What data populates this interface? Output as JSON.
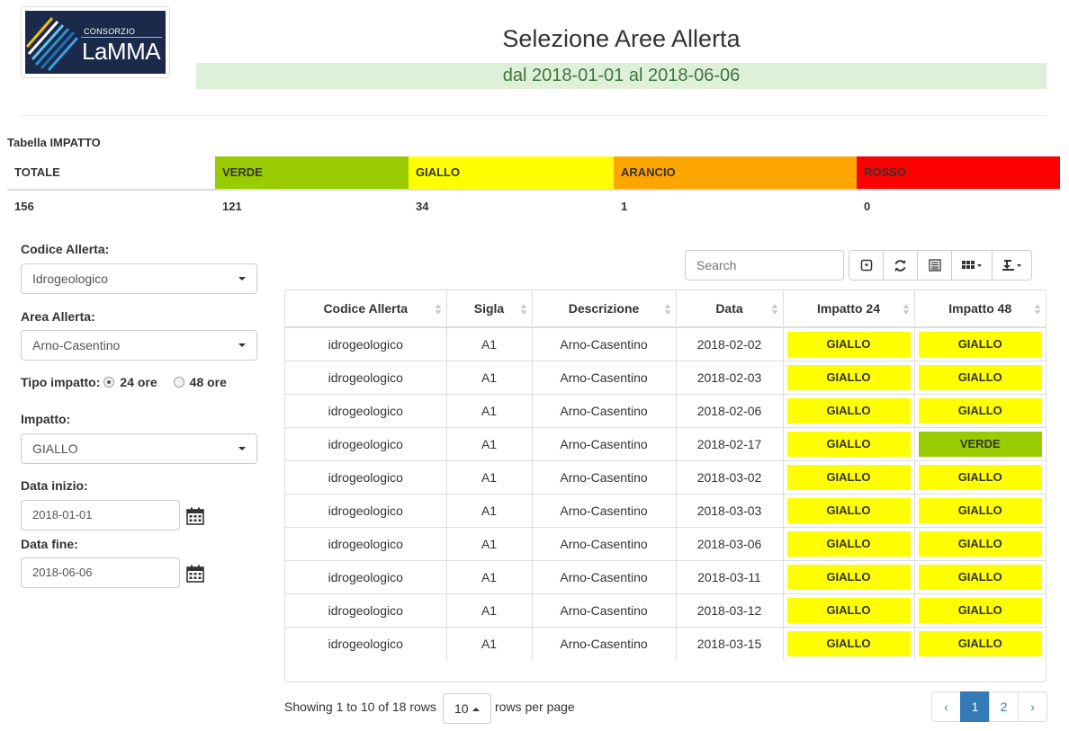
{
  "header": {
    "logo_small": "CONSORZIO",
    "logo_big": "LaMMA",
    "title": "Selezione Aree Allerta",
    "date_range": "dal 2018-01-01 al 2018-06-06"
  },
  "impact": {
    "caption": "Tabella IMPATTO",
    "headers": [
      "TOTALE",
      "VERDE",
      "GIALLO",
      "ARANCIO",
      "ROSSO"
    ],
    "values": [
      "156",
      "121",
      "34",
      "1",
      "0"
    ],
    "colors": {
      "verde": "#99cc00",
      "giallo": "#ffff00",
      "arancio": "#ffa500",
      "rosso": "#ff0000"
    }
  },
  "filters": {
    "codice_label": "Codice Allerta:",
    "codice_value": "Idrogeologico",
    "area_label": "Area Allerta:",
    "area_value": "Arno-Casentino",
    "tipo_label": "Tipo impatto:",
    "tipo_opt1": "24 ore",
    "tipo_opt2": "48 ore",
    "tipo_selected": "24 ore",
    "impatto_label": "Impatto:",
    "impatto_value": "GIALLO",
    "data_inizio_label": "Data inizio:",
    "data_inizio_value": "2018-01-01",
    "data_fine_label": "Data fine:",
    "data_fine_value": "2018-06-06"
  },
  "toolbar": {
    "search_placeholder": "Search",
    "icons": [
      "toggle-icon",
      "refresh-icon",
      "list-icon",
      "columns-icon",
      "export-icon"
    ]
  },
  "table": {
    "columns": [
      "Codice Allerta",
      "Sigla",
      "Descrizione",
      "Data",
      "Impatto 24",
      "Impatto 48"
    ],
    "rows": [
      [
        "idrogeologico",
        "A1",
        "Arno-Casentino",
        "2018-02-02",
        "GIALLO",
        "GIALLO"
      ],
      [
        "idrogeologico",
        "A1",
        "Arno-Casentino",
        "2018-02-03",
        "GIALLO",
        "GIALLO"
      ],
      [
        "idrogeologico",
        "A1",
        "Arno-Casentino",
        "2018-02-06",
        "GIALLO",
        "GIALLO"
      ],
      [
        "idrogeologico",
        "A1",
        "Arno-Casentino",
        "2018-02-17",
        "GIALLO",
        "VERDE"
      ],
      [
        "idrogeologico",
        "A1",
        "Arno-Casentino",
        "2018-03-02",
        "GIALLO",
        "GIALLO"
      ],
      [
        "idrogeologico",
        "A1",
        "Arno-Casentino",
        "2018-03-03",
        "GIALLO",
        "GIALLO"
      ],
      [
        "idrogeologico",
        "A1",
        "Arno-Casentino",
        "2018-03-06",
        "GIALLO",
        "GIALLO"
      ],
      [
        "idrogeologico",
        "A1",
        "Arno-Casentino",
        "2018-03-11",
        "GIALLO",
        "GIALLO"
      ],
      [
        "idrogeologico",
        "A1",
        "Arno-Casentino",
        "2018-03-12",
        "GIALLO",
        "GIALLO"
      ],
      [
        "idrogeologico",
        "A1",
        "Arno-Casentino",
        "2018-03-15",
        "GIALLO",
        "GIALLO"
      ]
    ]
  },
  "pagination": {
    "showing": "Showing 1 to 10 of 18 rows",
    "page_size": "10",
    "rows_per_page": "rows per page",
    "prev": "‹",
    "pages": [
      "1",
      "2"
    ],
    "current_page": "1",
    "next": "›"
  }
}
